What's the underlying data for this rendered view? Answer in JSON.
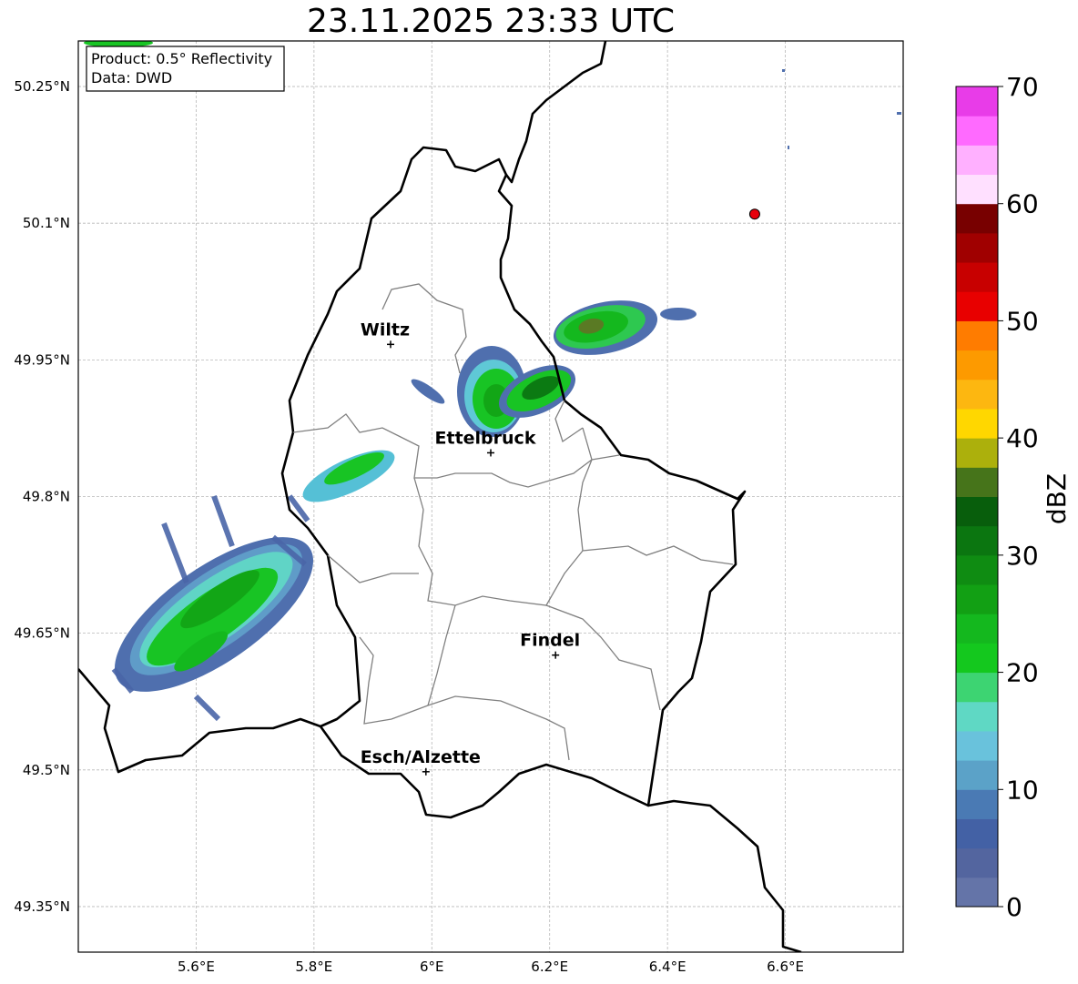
{
  "title": "23.11.2025 23:33 UTC",
  "info_box": {
    "line1": "Product: 0.5° Reflectivity",
    "line2": "Data: DWD"
  },
  "axes": {
    "lon_ticks": [
      "5.6°E",
      "5.8°E",
      "6°E",
      "6.2°E",
      "6.4°E",
      "6.6°E"
    ],
    "lat_ticks": [
      "50.25°N",
      "50.1°N",
      "49.95°N",
      "49.8°N",
      "49.65°N",
      "49.5°N",
      "49.35°N"
    ],
    "lon_values": [
      5.6,
      5.8,
      6.0,
      6.2,
      6.4,
      6.6
    ],
    "lat_values": [
      50.25,
      50.1,
      49.95,
      49.8,
      49.65,
      49.5,
      49.35
    ],
    "lon_range": [
      5.4,
      6.8
    ],
    "lat_range": [
      49.3,
      50.3
    ],
    "grid": true
  },
  "cities": [
    {
      "name": "Wiltz",
      "lon": 5.93,
      "lat": 49.967
    },
    {
      "name": "Ettelbruck",
      "lon": 6.1,
      "lat": 49.848
    },
    {
      "name": "Findel",
      "lon": 6.21,
      "lat": 49.626
    },
    {
      "name": "Esch/Alzette",
      "lon": 5.99,
      "lat": 49.498
    }
  ],
  "radar_site": {
    "lon": 6.548,
    "lat": 50.11,
    "color": "#e8000b"
  },
  "colorbar": {
    "label": "dBZ",
    "tick_labels": [
      "0",
      "10",
      "20",
      "30",
      "40",
      "50",
      "60",
      "70"
    ],
    "ticks": [
      0,
      10,
      20,
      30,
      40,
      50,
      60,
      70
    ],
    "min": 0,
    "max": 70,
    "step": 2.5,
    "colors": [
      "#6474a8",
      "#53659f",
      "#4361a5",
      "#4a7ab4",
      "#5ba2c8",
      "#69c2dc",
      "#5fd8c4",
      "#3dd472",
      "#14c81e",
      "#14b81e",
      "#12a014",
      "#0f8c12",
      "#0b7610",
      "#085e0c",
      "#46741a",
      "#acb00c",
      "#ffd700",
      "#fdb710",
      "#fd9a00",
      "#ff7c00",
      "#e80000",
      "#c80000",
      "#a00000",
      "#780000",
      "#ffe0ff",
      "#ffb0ff",
      "#ff6aff",
      "#e83ce8"
    ]
  }
}
